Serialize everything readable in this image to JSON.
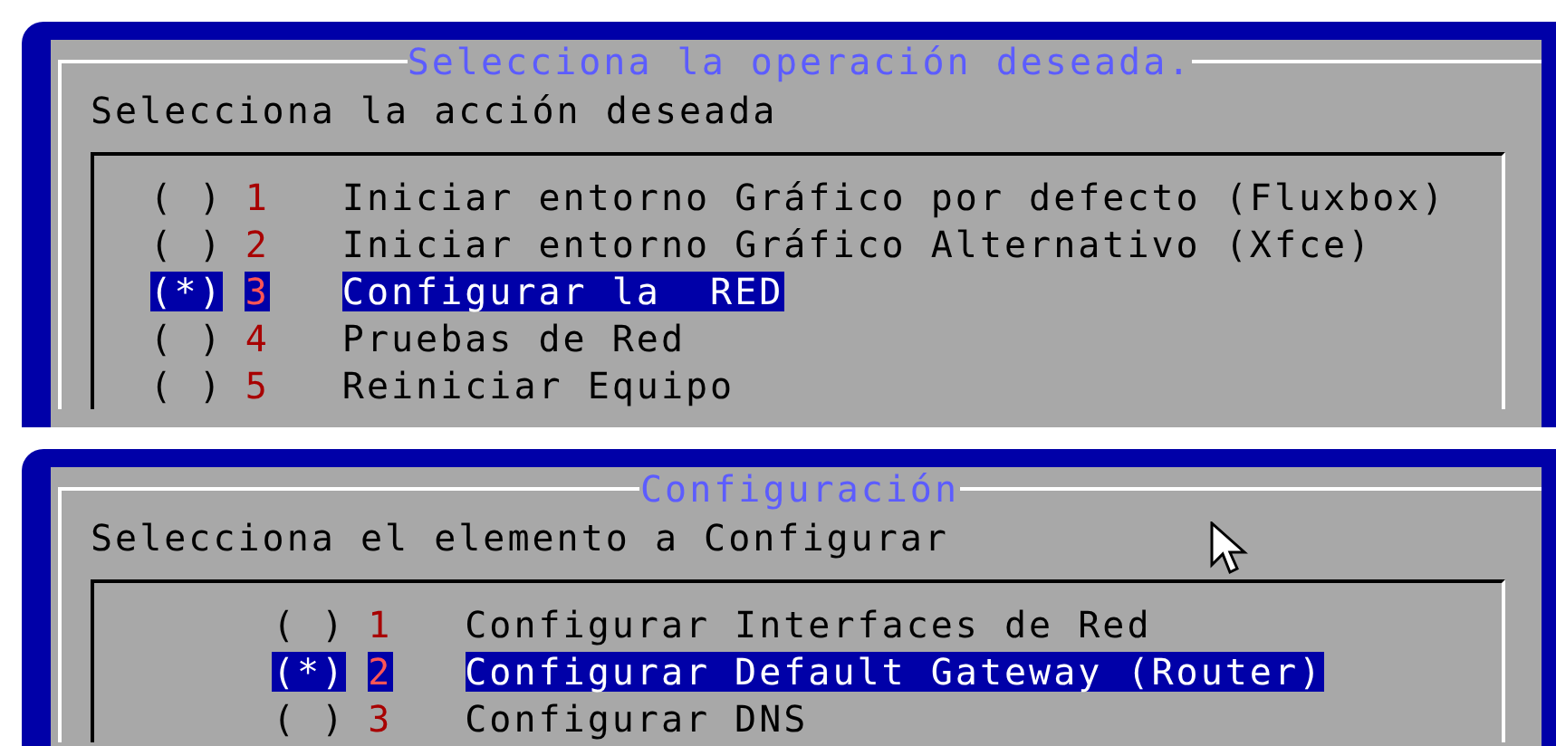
{
  "dialogs": [
    {
      "title": "Selecciona la operación deseada.",
      "prompt": "Selecciona la acción deseada",
      "options": [
        {
          "radio": "( )",
          "number": "1",
          "label": "Iniciar entorno Gráfico por defecto (Fluxbox)",
          "selected": false
        },
        {
          "radio": "( )",
          "number": "2",
          "label": "Iniciar entorno Gráfico Alternativo (Xfce)",
          "selected": false
        },
        {
          "radio": "(*)",
          "number": "3",
          "label": "Configurar la  RED",
          "selected": true
        },
        {
          "radio": "( )",
          "number": "4",
          "label": "Pruebas de Red",
          "selected": false
        },
        {
          "radio": "( )",
          "number": "5",
          "label": "Reiniciar Equipo",
          "selected": false
        }
      ]
    },
    {
      "title": "Configuración",
      "prompt": "Selecciona el elemento a Configurar",
      "options": [
        {
          "radio": "( )",
          "number": "1",
          "label": "Configurar Interfaces de Red",
          "selected": false
        },
        {
          "radio": "(*)",
          "number": "2",
          "label": "Configurar Default Gateway (Router)",
          "selected": true
        },
        {
          "radio": "( )",
          "number": "3",
          "label": "Configurar DNS",
          "selected": false
        }
      ]
    }
  ]
}
